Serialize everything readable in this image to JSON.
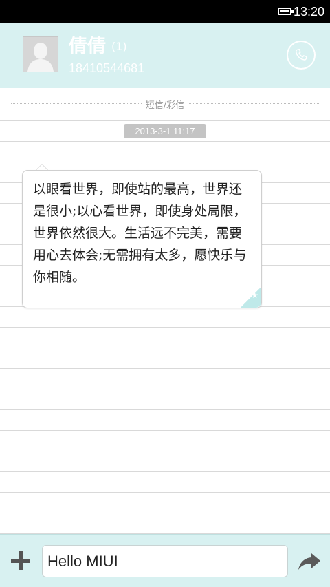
{
  "status_bar": {
    "time": "13:20"
  },
  "header": {
    "contact_name": "倩倩",
    "message_count": "(1)",
    "phone_number": "18410544681"
  },
  "conversation": {
    "type_label": "短信/彩信",
    "timestamp": "2013-3-1 11:17",
    "message_text": "以眼看世界，即使站的最高，世界还是很小;以心看世界，即使身处局限，世界依然很大。生活远不完美，需要用心去体会;无需拥有太多，愿快乐与你相随。"
  },
  "composer": {
    "input_value": "Hello MIUI"
  },
  "icons": {
    "battery": "battery-icon",
    "call": "phone-icon",
    "avatar": "default-avatar-icon",
    "add": "plus-icon",
    "send": "send-arrow-icon",
    "star": "star-icon"
  },
  "colors": {
    "header_bg": "#d8f1f1",
    "status_bar_bg": "#000000",
    "timestamp_bg": "#c4c4c4"
  }
}
